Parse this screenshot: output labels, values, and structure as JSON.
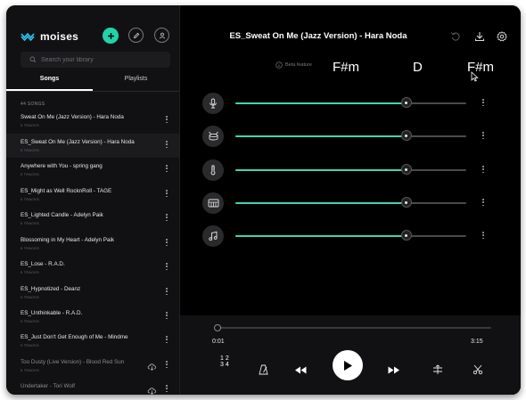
{
  "app": {
    "name": "moises"
  },
  "sidebar": {
    "search_placeholder": "Search your library",
    "tabs": [
      {
        "label": "Songs"
      },
      {
        "label": "Playlists"
      }
    ],
    "count_label": "44 SONGS",
    "songs": [
      {
        "title": "Sweat On Me (Jazz Version) - Hara Noda",
        "subtitle": "5 TRACKS"
      },
      {
        "title": "ES_Sweat On Me (Jazz Version) - Hara Noda",
        "subtitle": "5 TRACKS"
      },
      {
        "title": "Anywhere with You - spring gang",
        "subtitle": "5 TRACKS"
      },
      {
        "title": "ES_Might as Well RocknRoll - TAGE",
        "subtitle": "5 TRACKS"
      },
      {
        "title": "ES_Lighted Candle - Adelyn Paik",
        "subtitle": "5 TRACKS"
      },
      {
        "title": "Blossoming in My Heart - Adelyn Paik",
        "subtitle": "5 TRACKS"
      },
      {
        "title": "ES_Lose - R.A.D.",
        "subtitle": "5 TRACKS"
      },
      {
        "title": "ES_Hypnotized - Deanz",
        "subtitle": "5 TRACKS"
      },
      {
        "title": "ES_Unthinkable - R.A.D.",
        "subtitle": "5 TRACKS"
      },
      {
        "title": "ES_Just Don't Get Enough of Me - Mindme",
        "subtitle": "5 TRACKS"
      },
      {
        "title": "Too Dusty (Live Version) - Blood Red Sun",
        "subtitle": "5 TRACKS"
      },
      {
        "title": "Undertaker - Tori Wolf",
        "subtitle": ""
      }
    ]
  },
  "main": {
    "song_title": "ES_Sweat On Me (Jazz Version) - Hara Noda",
    "beta_label": "Beta feature",
    "chords": [
      "F#m",
      "D",
      "F#m"
    ],
    "tracks": [
      {
        "instrument": "microphone-icon",
        "level": 0.74
      },
      {
        "instrument": "drum-icon",
        "level": 0.74
      },
      {
        "instrument": "bass-guitar-icon",
        "level": 0.74
      },
      {
        "instrument": "piano-icon",
        "level": 0.74
      },
      {
        "instrument": "music-note-icon",
        "level": 0.74
      }
    ]
  },
  "player": {
    "current_time": "0:01",
    "total_time": "3:15",
    "progress": 0.005,
    "count_in_top": "1 2",
    "count_in_bottom": "3 4"
  },
  "colors": {
    "accent": "#21d3a9",
    "slider_fill": "#3fd6b1",
    "background": "#000000",
    "sidebar": "#111113"
  }
}
